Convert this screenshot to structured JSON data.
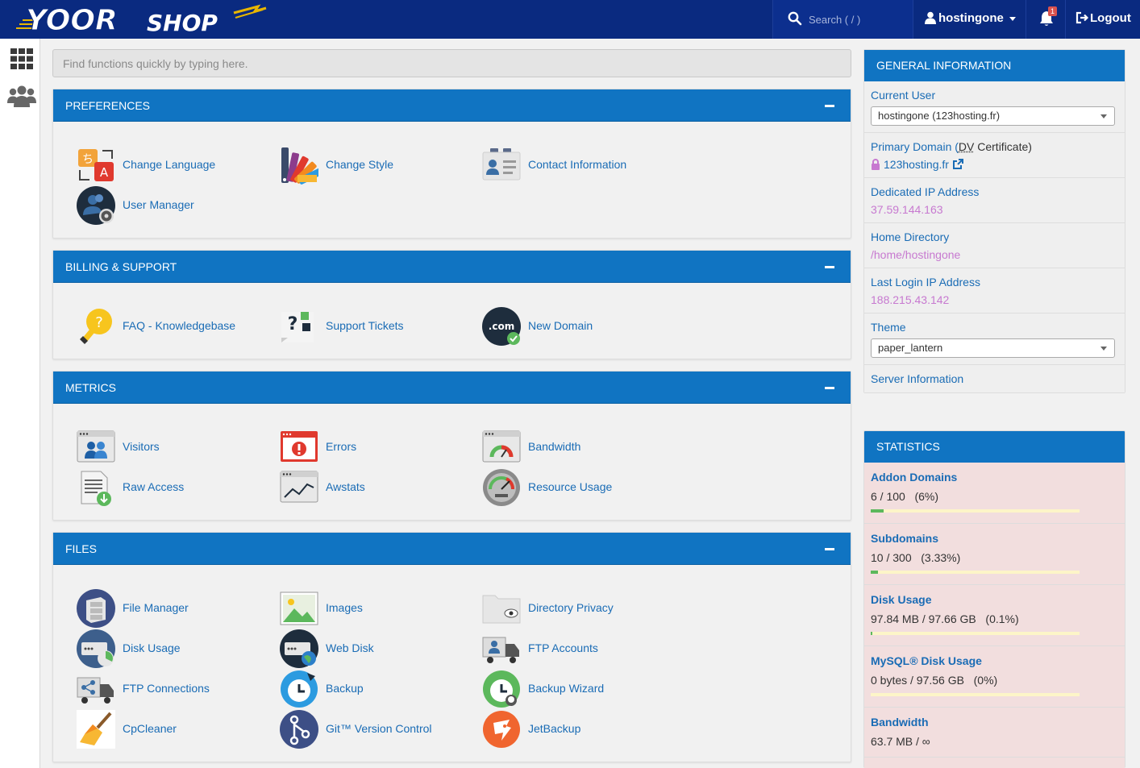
{
  "header": {
    "search_placeholder": "Search ( / )",
    "username": "hostingone",
    "notification_count": "1",
    "logout_label": "Logout"
  },
  "quickfind_placeholder": "Find functions quickly by typing here.",
  "sections": {
    "preferences": {
      "title": "PREFERENCES",
      "items": [
        "Change Language",
        "Change Style",
        "Contact Information",
        "User Manager"
      ]
    },
    "billing": {
      "title": "BILLING & SUPPORT",
      "items": [
        "FAQ - Knowledgebase",
        "Support Tickets",
        "New Domain"
      ]
    },
    "metrics": {
      "title": "METRICS",
      "items": [
        "Visitors",
        "Errors",
        "Bandwidth",
        "Raw Access",
        "Awstats",
        "Resource Usage"
      ]
    },
    "files": {
      "title": "FILES",
      "items": [
        "File Manager",
        "Images",
        "Directory Privacy",
        "Disk Usage",
        "Web Disk",
        "FTP Accounts",
        "FTP Connections",
        "Backup",
        "Backup Wizard",
        "CpCleaner",
        "Git™ Version Control",
        "JetBackup"
      ]
    }
  },
  "general_info": {
    "title": "GENERAL INFORMATION",
    "current_user_label": "Current User",
    "current_user_value": "hostingone (123hosting.fr)",
    "primary_domain_label": "Primary Domain (",
    "dv_label": "DV",
    "certificate_label": " Certificate)",
    "primary_domain_value": "123hosting.fr",
    "dedicated_ip_label": "Dedicated IP Address",
    "dedicated_ip_value": "37.59.144.163",
    "home_dir_label": "Home Directory",
    "home_dir_value": "/home/hostingone",
    "last_login_label": "Last Login IP Address",
    "last_login_value": "188.215.43.142",
    "theme_label": "Theme",
    "theme_value": "paper_lantern",
    "server_info_label": "Server Information"
  },
  "statistics": {
    "title": "STATISTICS",
    "rows": [
      {
        "label": "Addon Domains",
        "value": "6 / 100   (6%)",
        "fraction": 0.06
      },
      {
        "label": "Subdomains",
        "value": "10 / 300   (3.33%)",
        "fraction": 0.0333
      },
      {
        "label": "Disk Usage",
        "value": "97.84 MB / 97.66 GB   (0.1%)",
        "fraction": 0.001
      },
      {
        "label": "MySQL® Disk Usage",
        "value": "0 bytes / 97.56 GB   (0%)",
        "fraction": 0
      },
      {
        "label": "Bandwidth",
        "value": "63.7 MB / ∞"
      }
    ]
  },
  "colors": {
    "topbar": "#0a2a80",
    "panel_header": "#1074c2",
    "link": "#1a6cb5",
    "info_value": "#c779d0",
    "stats_bg": "#f2dede",
    "bar_fill": "#5cb85c"
  }
}
